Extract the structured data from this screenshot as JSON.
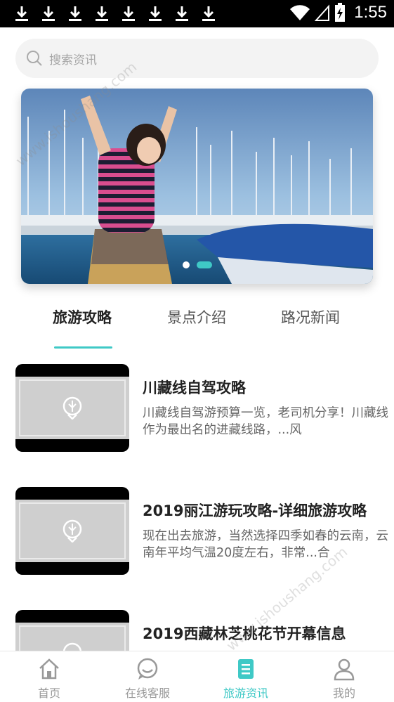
{
  "status_bar": {
    "time": "1:55",
    "icons": [
      "download-icon",
      "wifi-icon",
      "signal-icon",
      "battery-icon"
    ]
  },
  "search": {
    "placeholder": "搜索资讯"
  },
  "banner": {
    "slide_count": 2,
    "active_index": 1
  },
  "tabs": [
    {
      "label": "旅游攻略",
      "active": true
    },
    {
      "label": "景点介绍",
      "active": false
    },
    {
      "label": "路况新闻",
      "active": false
    }
  ],
  "articles": [
    {
      "title": "川藏线自驾攻略",
      "desc": "川藏线自驾游预算一览，老司机分享！川藏线作为最出名的进藏线路，...风"
    },
    {
      "title": "2019丽江游玩攻略-详细旅游攻略",
      "desc": "现在出去旅游，当然选择四季如春的云南，云南年平均气温20度左右，非常...合"
    },
    {
      "title": "2019西藏林芝桃花节开幕信息",
      "desc": ""
    }
  ],
  "bottom_nav": [
    {
      "label": "首页",
      "icon": "home-icon",
      "active": false
    },
    {
      "label": "在线客服",
      "icon": "chat-icon",
      "active": false
    },
    {
      "label": "旅游资讯",
      "icon": "document-icon",
      "active": true
    },
    {
      "label": "我的",
      "icon": "user-icon",
      "active": false
    }
  ],
  "watermark": "www.ishoushang.com",
  "colors": {
    "accent": "#3fc9c6",
    "status_bar": "#000000",
    "search_bg": "#f3f3f3",
    "inactive_nav": "#999999"
  }
}
